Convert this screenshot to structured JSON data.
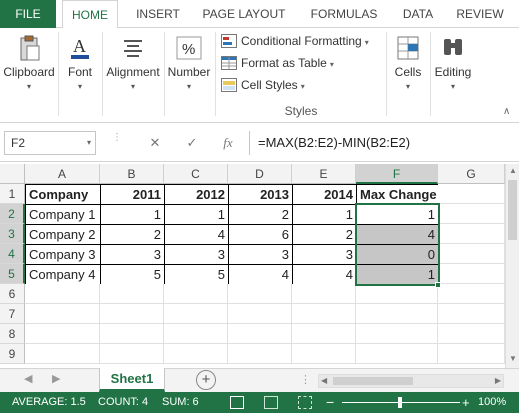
{
  "ribbon_tabs": [
    "FILE",
    "HOME",
    "INSERT",
    "PAGE LAYOUT",
    "FORMULAS",
    "DATA",
    "REVIEW"
  ],
  "groups": {
    "clipboard": "Clipboard",
    "font": "Font",
    "alignment": "Alignment",
    "number": "Number",
    "cells": "Cells",
    "editing": "Editing"
  },
  "styles": {
    "conditional": "Conditional Formatting",
    "format_table": "Format as Table",
    "cell_styles": "Cell Styles",
    "label": "Styles"
  },
  "formula_bar": {
    "name_box": "F2",
    "cancel": "✕",
    "enter": "✓",
    "fx": "fx",
    "formula": "=MAX(B2:E2)-MIN(B2:E2)"
  },
  "columns": [
    "A",
    "B",
    "C",
    "D",
    "E",
    "F",
    "G"
  ],
  "rows": [
    "1",
    "2",
    "3",
    "4",
    "5",
    "6",
    "7",
    "8",
    "9"
  ],
  "table": {
    "headers": [
      "Company",
      "2011",
      "2012",
      "2013",
      "2014",
      "Max Change"
    ],
    "rows": [
      [
        "Company 1",
        "1",
        "1",
        "2",
        "1",
        "1"
      ],
      [
        "Company 2",
        "2",
        "4",
        "6",
        "2",
        "4"
      ],
      [
        "Company 3",
        "3",
        "3",
        "3",
        "3",
        "0"
      ],
      [
        "Company 4",
        "5",
        "5",
        "4",
        "4",
        "1"
      ]
    ]
  },
  "sheet_tab": "Sheet1",
  "status": {
    "average": "AVERAGE: 1.5",
    "count": "COUNT: 4",
    "sum": "SUM: 6",
    "zoom": "100%"
  },
  "colors": {
    "accent": "#217346",
    "selection": "#c6c6c6"
  }
}
